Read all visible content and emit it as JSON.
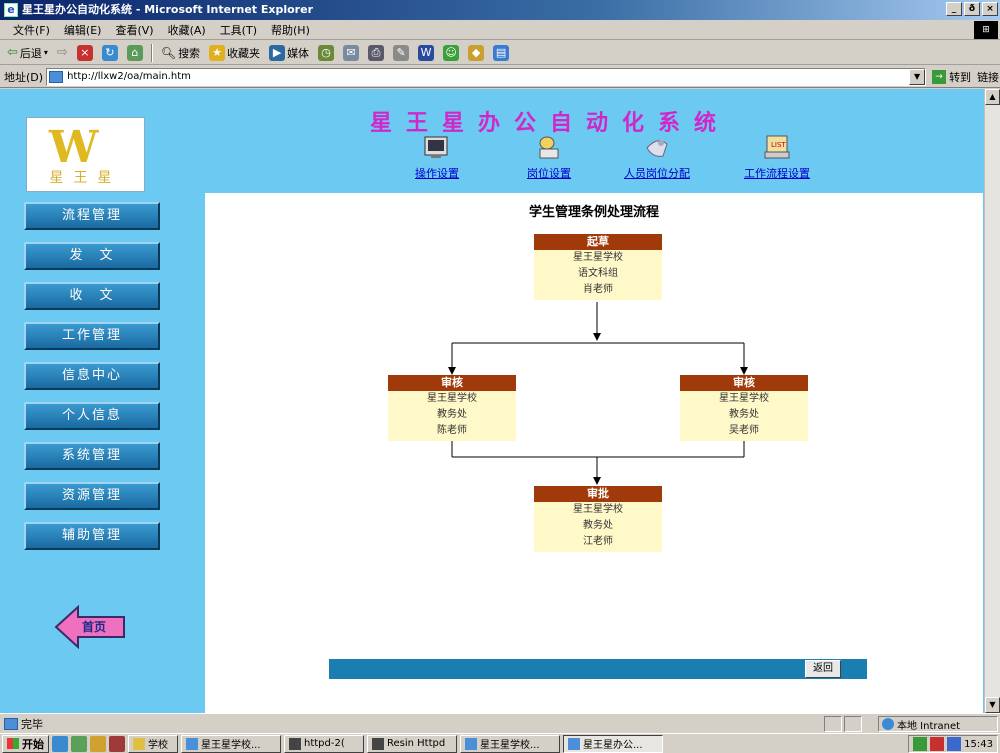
{
  "window": {
    "title": "星王星办公自动化系统 - Microsoft Internet Explorer",
    "controls": [
      "_",
      "ð",
      "×"
    ]
  },
  "menu": [
    "文件(F)",
    "编辑(E)",
    "查看(V)",
    "收藏(A)",
    "工具(T)",
    "帮助(H)"
  ],
  "toolbar": {
    "back": "后退",
    "search": "搜索",
    "favorites": "收藏夹",
    "media": "媒体"
  },
  "address": {
    "label": "地址(D)",
    "url": "http://llxw2/oa/main.htm",
    "go": "转到",
    "links": "链接"
  },
  "header": {
    "app_title": "星王星办公自动化系统",
    "logo_text": "星王星",
    "nav": [
      {
        "label": "操作设置",
        "icon": "settings-icon"
      },
      {
        "label": "岗位设置",
        "icon": "position-icon"
      },
      {
        "label": "人员岗位分配",
        "icon": "assign-icon"
      },
      {
        "label": "工作流程设置",
        "icon": "workflow-icon"
      }
    ]
  },
  "sidebar": {
    "items": [
      "流程管理",
      "发　文",
      "收　文",
      "工作管理",
      "信息中心",
      "个人信息",
      "系统管理",
      "资源管理",
      "辅助管理"
    ],
    "home": "首页"
  },
  "flow": {
    "title": "学生管理条例处理流程",
    "nodes": [
      {
        "head": "起草",
        "lines": [
          "星王星学校",
          "语文科组",
          "肖老师"
        ]
      },
      {
        "head": "审核",
        "lines": [
          "星王星学校",
          "教务处",
          "陈老师"
        ]
      },
      {
        "head": "审核",
        "lines": [
          "星王星学校",
          "教务处",
          "吴老师"
        ]
      },
      {
        "head": "审批",
        "lines": [
          "星王星学校",
          "教务处",
          "江老师"
        ]
      }
    ],
    "back_button": "返回"
  },
  "status": {
    "text": "完毕",
    "zone": "本地 Intranet"
  },
  "taskbar": {
    "start": "开始",
    "tasks": [
      "学校",
      "星王星学校...",
      "httpd-2(",
      "Resin Httpd",
      "星王星学校...",
      "星王星办公..."
    ],
    "clock": "15:43"
  },
  "colors": {
    "page_bg": "#6cc9f2",
    "sidebar_button": "#1a6aa0",
    "node_header": "#a03a0a",
    "node_body": "#fff8c8",
    "title_magenta": "#d028c8"
  }
}
